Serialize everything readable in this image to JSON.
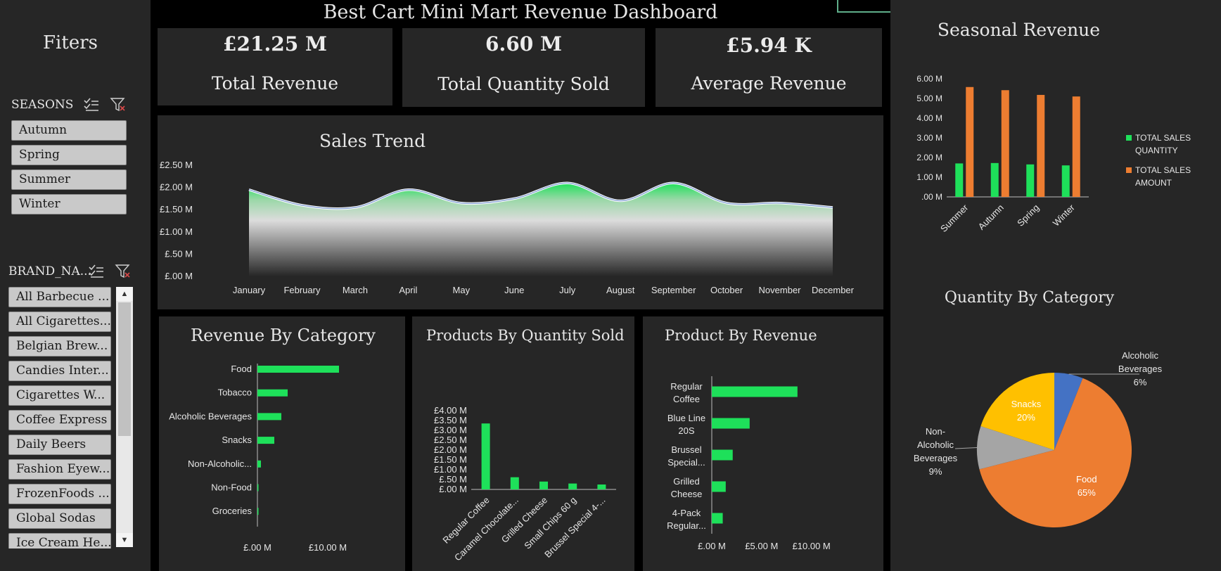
{
  "dashboard_title": "Best Cart Mini Mart Revenue Dashboard",
  "filters": {
    "title": "Fiters",
    "seasons": {
      "label": "SEASONS",
      "items": [
        "Autumn",
        "Spring",
        "Summer",
        "Winter"
      ]
    },
    "brands": {
      "label": "BRAND_NA...",
      "items": [
        "All Barbecue ...",
        "All Cigarettes...",
        "Belgian Brew...",
        "Candies Inter...",
        "Cigarettes W...",
        "Coffee Express",
        "Daily Beers",
        "Fashion Eyew...",
        "FrozenFoods ...",
        "Global Sodas",
        "Ice Cream He..."
      ]
    },
    "icons": {
      "multi_select": "multi-select-icon",
      "clear_filter": "clear-filter-icon"
    }
  },
  "kpis": [
    {
      "value": "£21.25 M",
      "label": "Total Revenue"
    },
    {
      "value": "6.60 M",
      "label": "Total Quantity Sold"
    },
    {
      "value": "£5.94 K",
      "label": "Average Revenue"
    }
  ],
  "colors": {
    "green": "#1ee05a",
    "orange": "#ed7d31",
    "blue": "#4472c4",
    "gray": "#a5a5a5",
    "yellow": "#ffc000"
  },
  "chart_data": [
    {
      "id": "sales_trend",
      "type": "area",
      "title": "Sales Trend",
      "categories": [
        "January",
        "February",
        "March",
        "April",
        "May",
        "June",
        "July",
        "August",
        "September",
        "October",
        "November",
        "December"
      ],
      "values": [
        1.95,
        1.6,
        1.55,
        1.95,
        1.65,
        1.75,
        2.1,
        1.7,
        2.1,
        1.65,
        1.65,
        1.55
      ],
      "ylim": [
        0,
        2.5
      ],
      "yticks": [
        "£.00 M",
        "£.50 M",
        "£1.00 M",
        "£1.50 M",
        "£2.00 M",
        "£2.50 M"
      ],
      "grid": false
    },
    {
      "id": "seasonal_revenue",
      "type": "bar",
      "title": "Seasonal Revenue",
      "categories": [
        "Summer",
        "Autumn",
        "Spring",
        "Winter"
      ],
      "series": [
        {
          "name": "TOTAL SALES QUANTITY",
          "values": [
            1.7,
            1.72,
            1.65,
            1.6
          ]
        },
        {
          "name": "TOTAL SALES AMOUNT",
          "values": [
            5.58,
            5.42,
            5.18,
            5.1
          ]
        }
      ],
      "ylim": [
        0,
        6
      ],
      "yticks": [
        ".00 M",
        "1.00 M",
        "2.00 M",
        "3.00 M",
        "4.00 M",
        "5.00 M",
        "6.00 M"
      ],
      "legend": "right"
    },
    {
      "id": "revenue_by_category",
      "type": "bar",
      "orientation": "horizontal",
      "title": "Revenue By Category",
      "categories": [
        "Food",
        "Tobacco",
        "Alcoholic Beverages",
        "Snacks",
        "Non-Alcoholic...",
        "Non-Food",
        "Groceries"
      ],
      "values": [
        11.6,
        4.3,
        3.4,
        2.4,
        0.5,
        0.1,
        0.1
      ],
      "xticks": [
        "£.00 M",
        "£10.00 M"
      ],
      "xlim": [
        0,
        20
      ]
    },
    {
      "id": "products_by_quantity",
      "type": "bar",
      "title": "Products By Quantity Sold",
      "categories": [
        "Regular Coffee",
        "Caramel Chocolate...",
        "Grilled Cheese",
        "Small Chips 60 g",
        "Brussel Special 4-..."
      ],
      "values": [
        3.35,
        0.62,
        0.4,
        0.3,
        0.25
      ],
      "ylim": [
        0,
        4
      ],
      "yticks": [
        "£.00 M",
        "£.50 M",
        "£1.00 M",
        "£1.50 M",
        "£2.00 M",
        "£2.50 M",
        "£3.00 M",
        "£3.50 M",
        "£4.00 M"
      ]
    },
    {
      "id": "product_by_revenue",
      "type": "bar",
      "orientation": "horizontal",
      "title": "Product By Revenue",
      "categories": [
        [
          "Regular",
          "Coffee"
        ],
        [
          "Blue Line",
          "20S"
        ],
        [
          "Brussel",
          "Special..."
        ],
        [
          "Grilled",
          "Cheese"
        ],
        [
          "4-Pack",
          "Regular..."
        ]
      ],
      "values": [
        8.6,
        3.8,
        2.1,
        1.4,
        1.1
      ],
      "xticks": [
        "£.00 M",
        "£5.00 M",
        "£10.00 M"
      ],
      "xlim": [
        0,
        12
      ]
    },
    {
      "id": "quantity_by_category",
      "type": "pie",
      "title": "Quantity By Category",
      "slices": [
        {
          "name": "Alcoholic Beverages",
          "label_lines": [
            "Alcoholic",
            "Beverages"
          ],
          "pct": "6%",
          "value": 6,
          "color": "#4472c4"
        },
        {
          "name": "Food",
          "label_lines": [
            "Food"
          ],
          "pct": "65%",
          "value": 65,
          "color": "#ed7d31"
        },
        {
          "name": "Non-Alcoholic Beverages",
          "label_lines": [
            "Non-",
            "Alcoholic",
            "Beverages"
          ],
          "pct": "9%",
          "value": 9,
          "color": "#a5a5a5"
        },
        {
          "name": "Snacks",
          "label_lines": [
            "Snacks"
          ],
          "pct": "20%",
          "value": 20,
          "color": "#ffc000"
        }
      ]
    }
  ]
}
